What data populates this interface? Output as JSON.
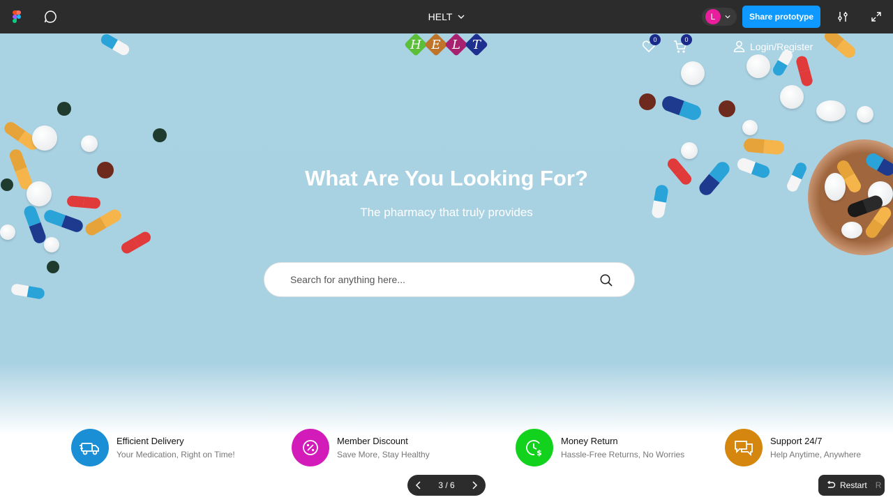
{
  "toolbar": {
    "file_title": "HELT",
    "avatar_initial": "L",
    "share_label": "Share prototype",
    "icons": [
      "figma-logo-icon",
      "comment-icon",
      "chevron-down-icon",
      "settings-sliders-icon",
      "expand-icon"
    ]
  },
  "header": {
    "logo_text": "HELT",
    "wishlist_count": "0",
    "cart_count": "0",
    "login_label": "Login/Register"
  },
  "hero": {
    "headline": "What Are You Looking For?",
    "subline": "The pharmacy that truly provides",
    "search_placeholder": "Search for anything here..."
  },
  "features": [
    {
      "title": "Efficient Delivery",
      "subtitle": "Your Medication, Right on Time!",
      "icon": "delivery-truck-icon",
      "color": "#1a8fd6"
    },
    {
      "title": "Member Discount",
      "subtitle": "Save More, Stay Healthy",
      "icon": "percent-icon",
      "color": "#d21bb8"
    },
    {
      "title": "Money Return",
      "subtitle": "Hassle-Free Returns, No Worries",
      "icon": "clock-dollar-icon",
      "color": "#12d21e"
    },
    {
      "title": "Support 24/7",
      "subtitle": "Help Anytime, Anywhere",
      "icon": "chat-bubbles-icon",
      "color": "#d4860f"
    }
  ],
  "pager": {
    "label": "3 / 6"
  },
  "restart": {
    "label": "Restart",
    "shortcut": "R"
  },
  "colors": {
    "toolbar_bg": "#2c2c2c",
    "share_blue": "#0d99ff",
    "hero_bg": "#a9d2e3",
    "badge": "#1a2a8a"
  }
}
